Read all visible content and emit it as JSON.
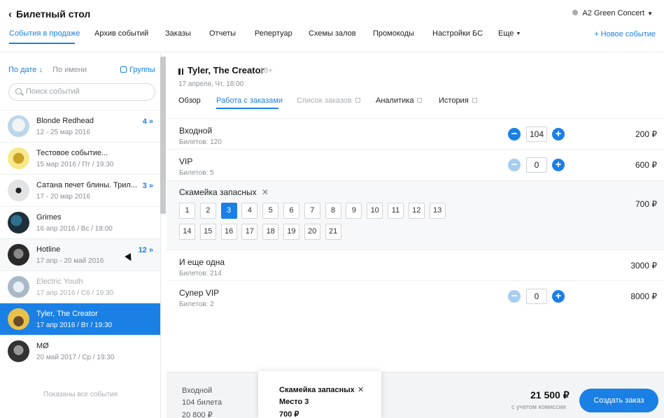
{
  "header": {
    "back_label": "Билетный стол",
    "org_label": "A2 Green Concert",
    "nav": [
      "События в продаже",
      "Архив событий",
      "Заказы",
      "Отчеты",
      "Репертуар",
      "Схемы залов",
      "Промокоды",
      "Настройки БС",
      "Еще"
    ],
    "new_event_label": "+ Новое событие"
  },
  "sidebar": {
    "sort_date": "По дате",
    "sort_name": "По имени",
    "groups_label": "Группы",
    "search_placeholder": "Поиск событий",
    "events": [
      {
        "title": "Blonde Redhead",
        "date": "12 - 25 мар 2016",
        "count": "4"
      },
      {
        "title": "Тестовое событие...",
        "date": "15 мар 2016 / Пт / 19:30",
        "count": ""
      },
      {
        "title": "Сатана печет блины. Трил...",
        "date": "17 - 20 мар 2016",
        "count": "3"
      },
      {
        "title": "Grimes",
        "date": "16 апр 2016 / Вс / 18:00",
        "count": ""
      },
      {
        "title": "Hotline",
        "date": "17 апр  - 20 май 2016",
        "count": "12"
      },
      {
        "title": "Electric Youth",
        "date": "17 апр 2016 / Сб / 19:30",
        "count": ""
      },
      {
        "title": "Tyler, The Creator",
        "date": "17 апр 2016 / Вт / 19:30",
        "count": ""
      },
      {
        "title": "MØ",
        "date": "20 май 2017 / Ср / 19:30",
        "count": ""
      }
    ],
    "all_shown": "Показаны все события"
  },
  "event": {
    "title": "Tyler, The Creator",
    "age": "18+",
    "date": "17 апреля, Чт, 18:00",
    "tabs": [
      "Обзор",
      "Работа с заказами",
      "Список заказов",
      "Аналитика",
      "История"
    ]
  },
  "tickets": [
    {
      "name": "Входной",
      "sub": "Билетов: 120",
      "qty": "104",
      "price": "200 ₽"
    },
    {
      "name": "VIP",
      "sub": "Билетов: 5",
      "qty": "0",
      "price": "600 ₽"
    },
    {
      "name": "Скамейка запасных",
      "sub": "",
      "qty": "",
      "price": "700 ₽"
    },
    {
      "name": "И еще одна",
      "sub": "Билетов: 214",
      "qty": "",
      "price": "3000 ₽"
    },
    {
      "name": "Супер VIP",
      "sub": "Билетов: 2",
      "qty": "0",
      "price": "8000 ₽"
    }
  ],
  "seats": [
    "1",
    "2",
    "3",
    "4",
    "5",
    "6",
    "7",
    "8",
    "9",
    "10",
    "11",
    "12",
    "13",
    "14",
    "15",
    "16",
    "17",
    "18",
    "19",
    "20",
    "21"
  ],
  "selected_seat": "3",
  "bottom": {
    "left_name": "Входной",
    "left_qty": "104 билета",
    "left_sum": "20 800 ₽",
    "card_title": "Скамейка запасных",
    "card_seat": "Место 3",
    "card_price": "700 ₽",
    "total": "21 500 ₽",
    "total_note": "с учетом комиссии",
    "create_label": "Создать заказ"
  },
  "colors": {
    "accent": "#1a80e6",
    "accent_disabled": "#a7cdf0"
  }
}
